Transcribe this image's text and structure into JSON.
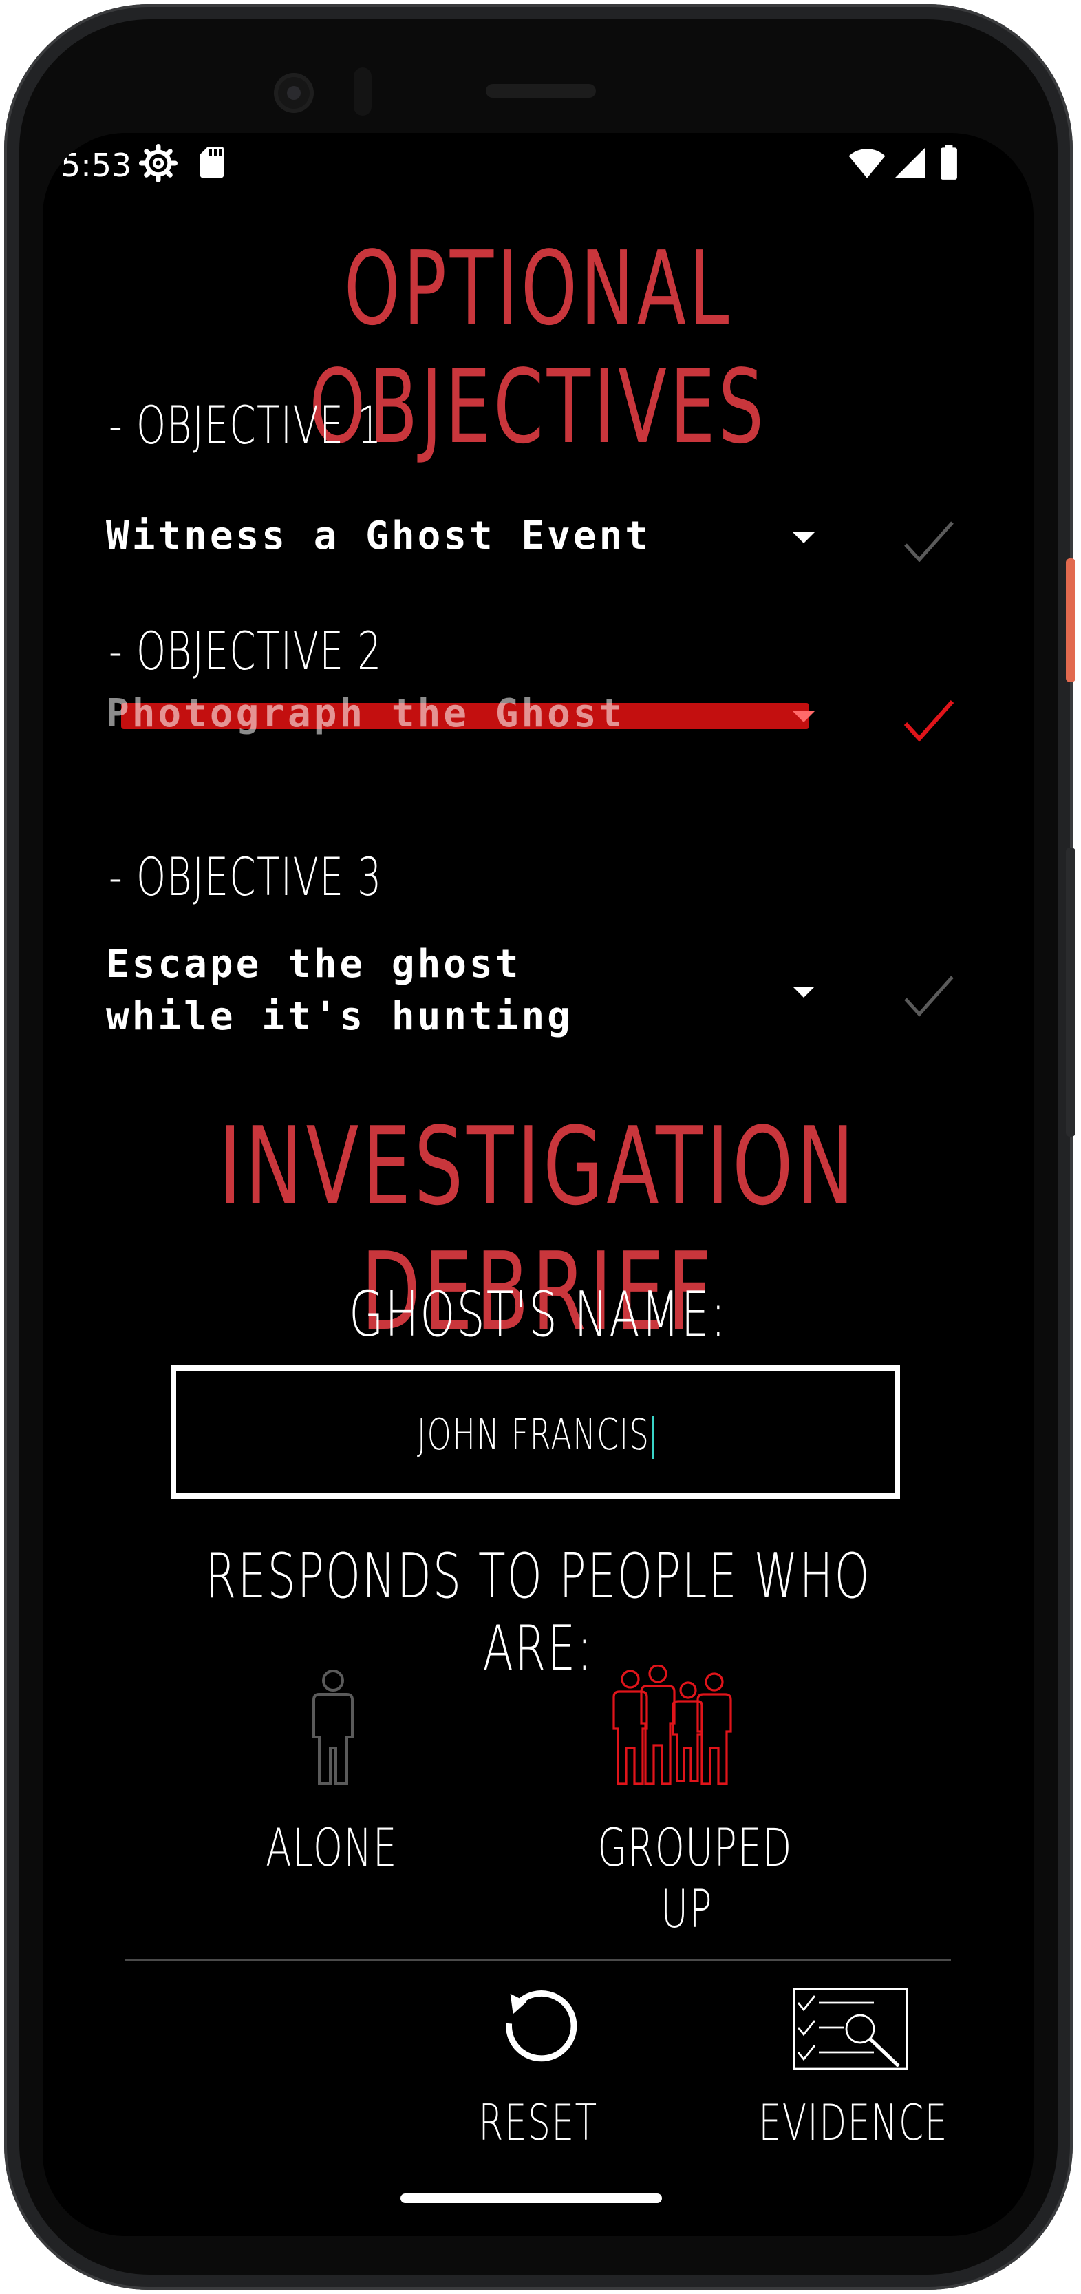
{
  "status_bar": {
    "time": "5:53",
    "icons": [
      "settings-gear-icon",
      "sd-card-icon",
      "wifi-icon",
      "cell-signal-icon",
      "battery-icon"
    ]
  },
  "optional_objectives": {
    "title": "OPTIONAL OBJECTIVES",
    "items": [
      {
        "label": "- OBJECTIVE 1",
        "value": "Witness a Ghost Event",
        "completed": false
      },
      {
        "label": "- OBJECTIVE 2",
        "value": "Photograph the Ghost",
        "completed": true
      },
      {
        "label": "- OBJECTIVE 3",
        "value_line1": "Escape the ghost",
        "value_line2": "while it's hunting",
        "completed": false
      }
    ]
  },
  "investigation_debrief": {
    "title": "INVESTIGATION DEBRIEF",
    "ghost_name_label": "GHOST'S NAME:",
    "ghost_name_value": "JOHN FRANCIS",
    "responds_label": "RESPONDS TO PEOPLE WHO ARE:",
    "options": [
      {
        "label": "ALONE",
        "selected": false
      },
      {
        "label": "GROUPED UP",
        "selected": true
      }
    ]
  },
  "bottom_nav": {
    "reset_label": "RESET",
    "evidence_label": "EVIDENCE"
  },
  "colors": {
    "accent_red": "#c9363c",
    "strike_red": "#d41010",
    "check_active": "#e0141a",
    "check_inactive": "#5a5a5a",
    "cursor": "#3ad4c8"
  }
}
